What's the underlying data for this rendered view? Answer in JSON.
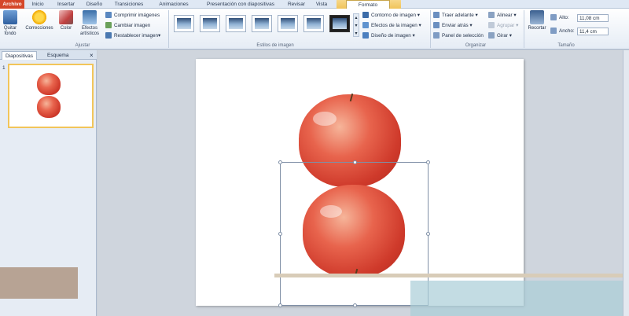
{
  "tabs": {
    "file": "Archivo",
    "items": [
      "Inicio",
      "Insertar",
      "Diseño",
      "Transiciones",
      "Animaciones",
      "Presentación con diapositivas",
      "Revisar",
      "Vista"
    ],
    "context": "Formato"
  },
  "ribbon": {
    "adjust": {
      "remove_bg": "Quitar fondo",
      "corrections": "Correcciones",
      "color": "Color",
      "artistic": "Efectos artísticos",
      "compress": "Comprimir imágenes",
      "change": "Cambiar imagen",
      "reset": "Restablecer imagen",
      "label": "Ajustar"
    },
    "styles": {
      "label": "Estilos de imagen",
      "border": "Contorno de imagen",
      "effects": "Efectos de la imagen",
      "layout": "Diseño de imagen"
    },
    "arrange": {
      "forward": "Traer adelante",
      "backward": "Enviar atrás",
      "selection_pane": "Panel de selección",
      "align": "Alinear",
      "group": "Agrupar",
      "rotate": "Girar",
      "label": "Organizar"
    },
    "size": {
      "crop": "Recortar",
      "height_label": "Alto:",
      "height_value": "11,08 cm",
      "width_label": "Ancho:",
      "width_value": "11,4 cm",
      "label": "Tamaño"
    }
  },
  "pane": {
    "tab_slides": "Diapositivas",
    "tab_outline": "Esquema",
    "close": "×",
    "slide_number": "1"
  },
  "colors": {
    "file_tab": "#d5472a",
    "context_tab": "#f0c35a",
    "apple_red": "#cf3a2b"
  }
}
